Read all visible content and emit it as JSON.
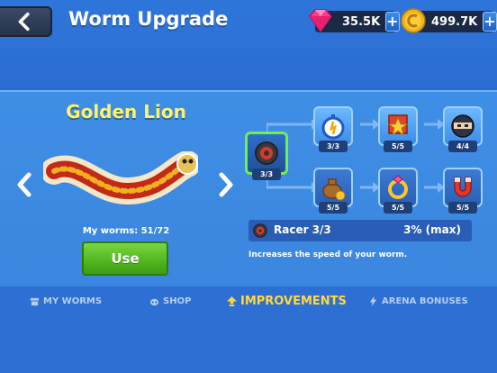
{
  "header": {
    "title": "Worm Upgrade",
    "gems": "35.5K",
    "coins": "499.7K",
    "plus_label": "+"
  },
  "worm": {
    "name": "Golden Lion",
    "my_worms": "My worms: 51/72",
    "use_label": "Use"
  },
  "tree": {
    "nodes": [
      {
        "name": "racer",
        "level": "3/3"
      },
      {
        "name": "stopwatch",
        "level": "3/3"
      },
      {
        "name": "star-badge",
        "level": "5/5"
      },
      {
        "name": "ninja",
        "level": "4/4"
      },
      {
        "name": "money-bag",
        "level": "5/5"
      },
      {
        "name": "ring",
        "level": "5/5"
      },
      {
        "name": "magnet",
        "level": "5/5"
      }
    ]
  },
  "selected_upgrade": {
    "name": "Racer 3/3",
    "value": "3% (max)",
    "description": "Increases the speed of your worm."
  },
  "tabs": [
    {
      "label": "MY WORMS",
      "icon": "box-icon"
    },
    {
      "label": "SHOP",
      "icon": "shop-icon"
    },
    {
      "label": "IMPROVEMENTS",
      "icon": "arrow-up-icon",
      "active": true
    },
    {
      "label": "ARENA BONUSES",
      "icon": "bolt-icon"
    }
  ],
  "colors": {
    "background": "#2c6fd4",
    "panel": "#3f8ee6",
    "accent_yellow": "#ffd93a",
    "use_green": "#4fb51f",
    "selected_border": "#6ff04a"
  }
}
